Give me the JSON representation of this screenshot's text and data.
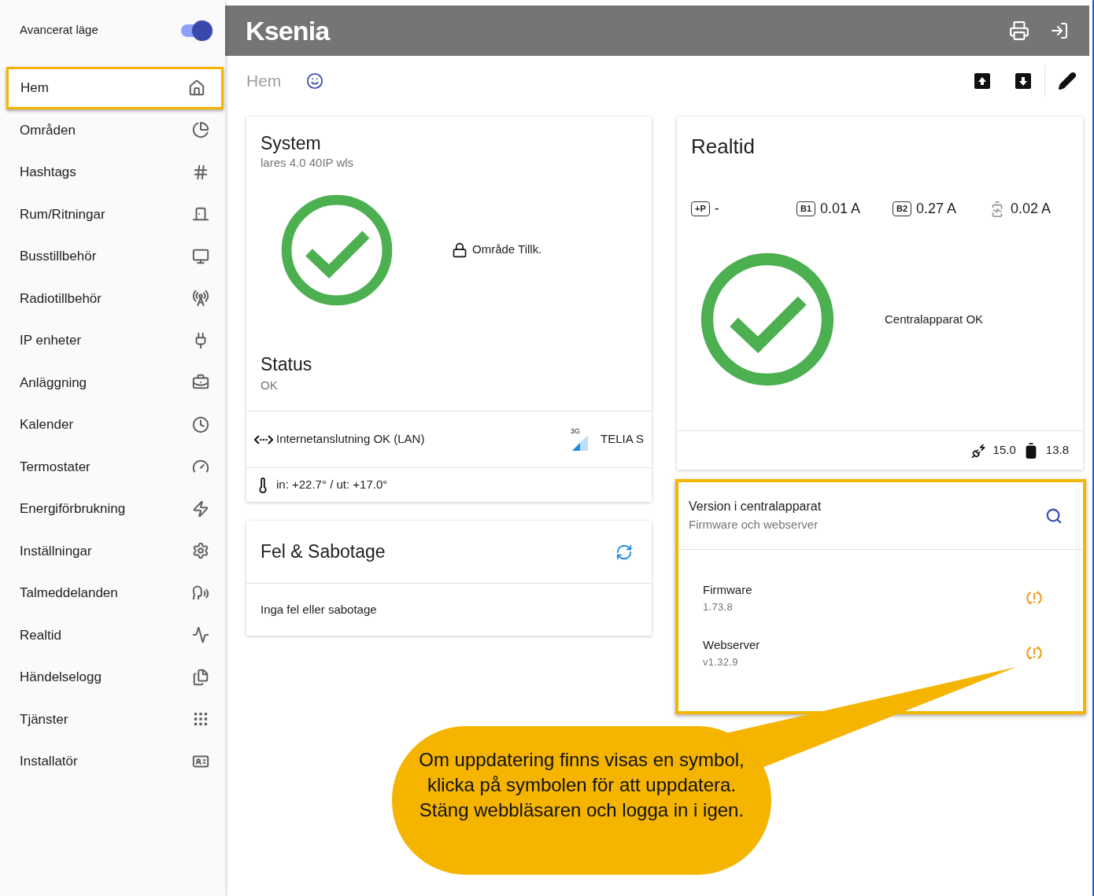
{
  "sidebar": {
    "advanced_mode": {
      "label": "Avancerat läge",
      "on": true
    },
    "items": [
      {
        "label": "Hem",
        "selected": true
      },
      {
        "label": "Områden",
        "selected": false
      },
      {
        "label": "Hashtags",
        "selected": false
      },
      {
        "label": "Rum/Ritningar",
        "selected": false
      },
      {
        "label": "Busstillbehör",
        "selected": false
      },
      {
        "label": "Radiotillbehör",
        "selected": false
      },
      {
        "label": "IP enheter",
        "selected": false
      },
      {
        "label": "Anläggning",
        "selected": false
      },
      {
        "label": "Kalender",
        "selected": false
      },
      {
        "label": "Termostater",
        "selected": false
      },
      {
        "label": "Energiförbrukning",
        "selected": false
      },
      {
        "label": "Inställningar",
        "selected": false
      },
      {
        "label": "Talmeddelanden",
        "selected": false
      },
      {
        "label": "Realtid",
        "selected": false
      },
      {
        "label": "Händelselogg",
        "selected": false
      },
      {
        "label": "Tjänster",
        "selected": false
      },
      {
        "label": "Installatör",
        "selected": false
      }
    ]
  },
  "header": {
    "logo": "Ksenia"
  },
  "page": {
    "title": "Hem"
  },
  "system_card": {
    "title": "System",
    "subtitle": "lares 4.0 40IP wls",
    "area_status": "Område Tillk.",
    "status_label": "Status",
    "status_value": "OK",
    "internet": "Internetanslutning OK (LAN)",
    "network_type": "3G",
    "operator": "TELIA S",
    "temperature": "in: +22.7° / ut: +17.0°"
  },
  "faults_card": {
    "title": "Fel & Sabotage",
    "message": "Inga fel eller sabotage"
  },
  "realtime_card": {
    "title": "Realtid",
    "readings": [
      {
        "kind": "badge",
        "badge": "+P",
        "value": "-"
      },
      {
        "kind": "badge",
        "badge": "B1",
        "value": "0.01 A"
      },
      {
        "kind": "badge",
        "badge": "B2",
        "value": "0.27 A"
      },
      {
        "kind": "battery",
        "value": "0.02 A"
      }
    ],
    "status": "Centralapparat OK",
    "power_supply": "15.0",
    "battery": "13.8"
  },
  "version_card": {
    "title": "Version i centralapparat",
    "subtitle": "Firmware och webserver",
    "highlighted": true,
    "items": [
      {
        "name": "Firmware",
        "version": "1.73.8",
        "update_available": true
      },
      {
        "name": "Webserver",
        "version": "v1.32.9",
        "update_available": true
      }
    ]
  },
  "callout": {
    "text": "Om uppdatering finns visas en symbol, klicka på symbolen för att uppdatera. Stäng webbläsaren och logga in i igen."
  }
}
